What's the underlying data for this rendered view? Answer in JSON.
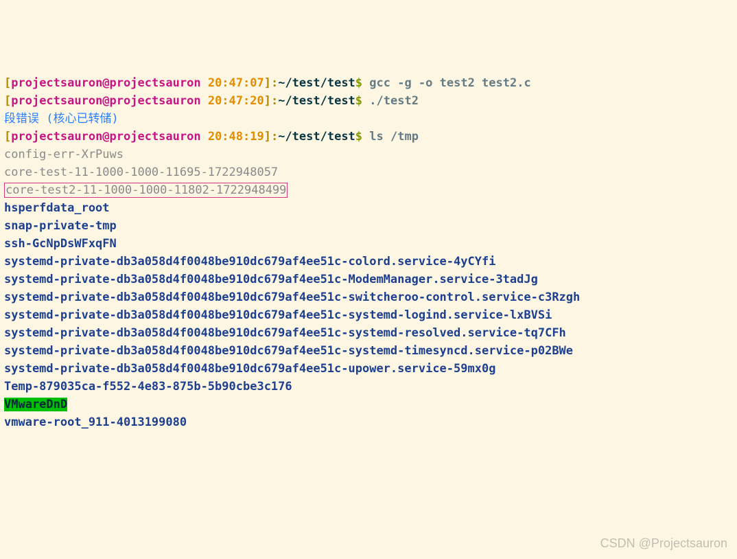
{
  "p1": {
    "lb": "[",
    "user": "projectsauron@projectsauron ",
    "time": "20:47:07",
    "rb": "]:",
    "path": "~/test/test",
    "dollar": "$ ",
    "cmd": "gcc -g -o test2 test2.c"
  },
  "p2": {
    "lb": "[",
    "user": "projectsauron@projectsauron ",
    "time": "20:47:20",
    "rb": "]:",
    "path": "~/test/test",
    "dollar": "$ ",
    "cmd": "./test2"
  },
  "segfault": "段错误 (核心已转储)",
  "p3": {
    "lb": "[",
    "user": "projectsauron@projectsauron ",
    "time": "20:48:19",
    "rb": "]:",
    "path": "~/test/test",
    "dollar": "$ ",
    "cmd": "ls /tmp"
  },
  "files": {
    "f0": "config-err-XrPuws",
    "f1": "core-test-11-1000-1000-11695-1722948057",
    "f2": "core-test2-11-1000-1000-11802-1722948499"
  },
  "dirs": {
    "d0": "hsperfdata_root",
    "d1": "snap-private-tmp",
    "d2": "ssh-GcNpDsWFxqFN",
    "d3": "systemd-private-db3a058d4f0048be910dc679af4ee51c-colord.service-4yCYfi",
    "d4": "systemd-private-db3a058d4f0048be910dc679af4ee51c-ModemManager.service-3tadJg",
    "d5": "systemd-private-db3a058d4f0048be910dc679af4ee51c-switcheroo-control.service-c3Rzgh",
    "d6": "systemd-private-db3a058d4f0048be910dc679af4ee51c-systemd-logind.service-lxBVSi",
    "d7": "systemd-private-db3a058d4f0048be910dc679af4ee51c-systemd-resolved.service-tq7CFh",
    "d8": "systemd-private-db3a058d4f0048be910dc679af4ee51c-systemd-timesyncd.service-p02BWe",
    "d9": "systemd-private-db3a058d4f0048be910dc679af4ee51c-upower.service-59mx0g",
    "d10": "Temp-879035ca-f552-4e83-875b-5b90cbe3c176",
    "d11": "VMwareDnD",
    "d12": "vmware-root_911-4013199080"
  },
  "watermark": "CSDN @Projectsauron"
}
